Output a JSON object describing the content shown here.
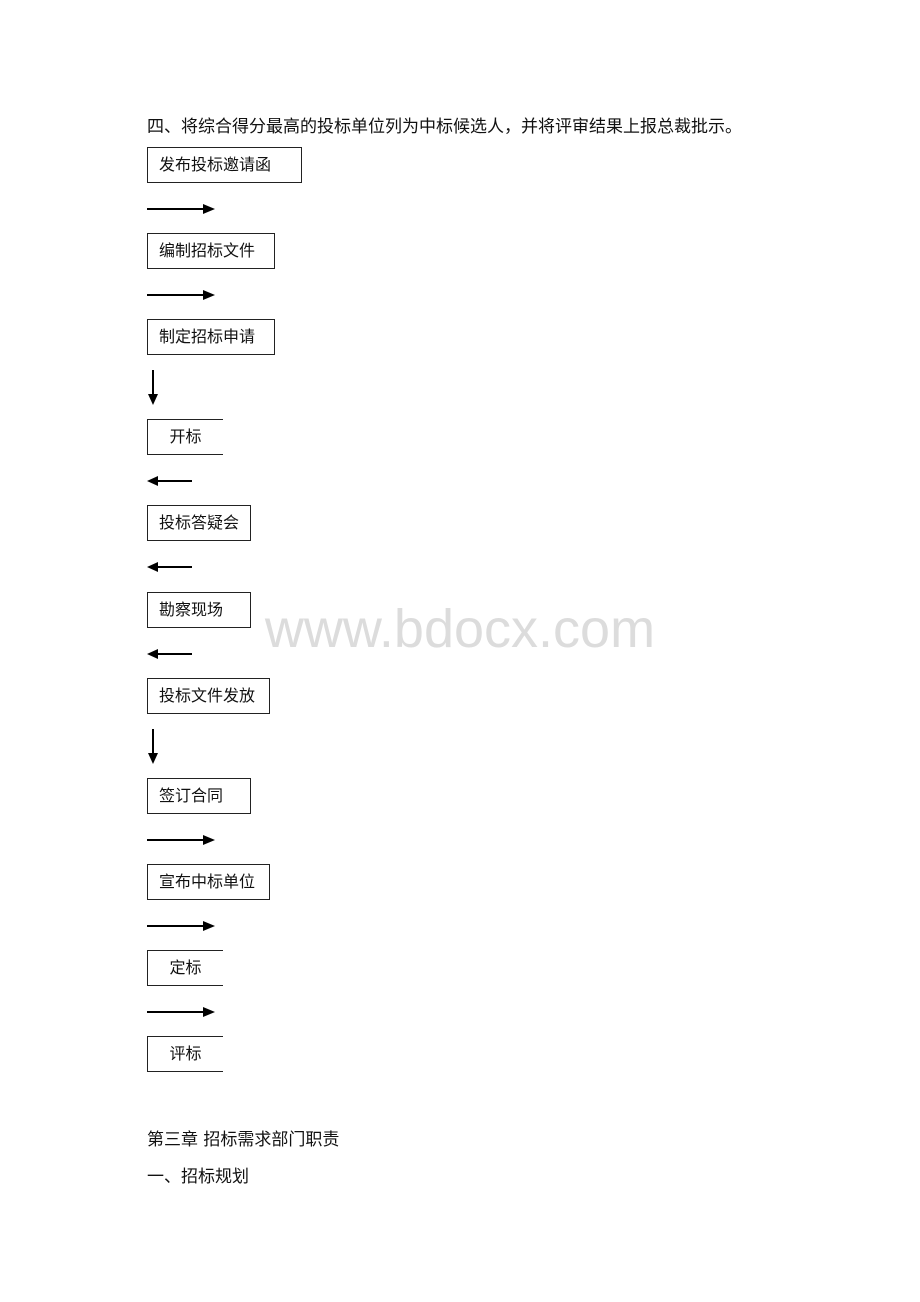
{
  "intro": "四、将综合得分最高的投标单位列为中标候选人，并将评审结果上报总裁批示。",
  "flow": [
    {
      "label": "发布投标邀请函",
      "next_arrow": "right"
    },
    {
      "label": "编制招标文件",
      "next_arrow": "right"
    },
    {
      "label": "制定招标申请",
      "next_arrow": "down"
    },
    {
      "label": "开标",
      "next_arrow": "left"
    },
    {
      "label": "投标答疑会",
      "next_arrow": "left"
    },
    {
      "label": "勘察现场",
      "next_arrow": "left"
    },
    {
      "label": "投标文件发放",
      "next_arrow": "down"
    },
    {
      "label": "签订合同",
      "next_arrow": "right"
    },
    {
      "label": "宣布中标单位",
      "next_arrow": "right"
    },
    {
      "label": "定标",
      "next_arrow": "right"
    },
    {
      "label": "评标",
      "next_arrow": null
    }
  ],
  "chapter_heading": "第三章 招标需求部门职责",
  "section_heading": "一、招标规划",
  "watermark": "www.bdocx.com"
}
